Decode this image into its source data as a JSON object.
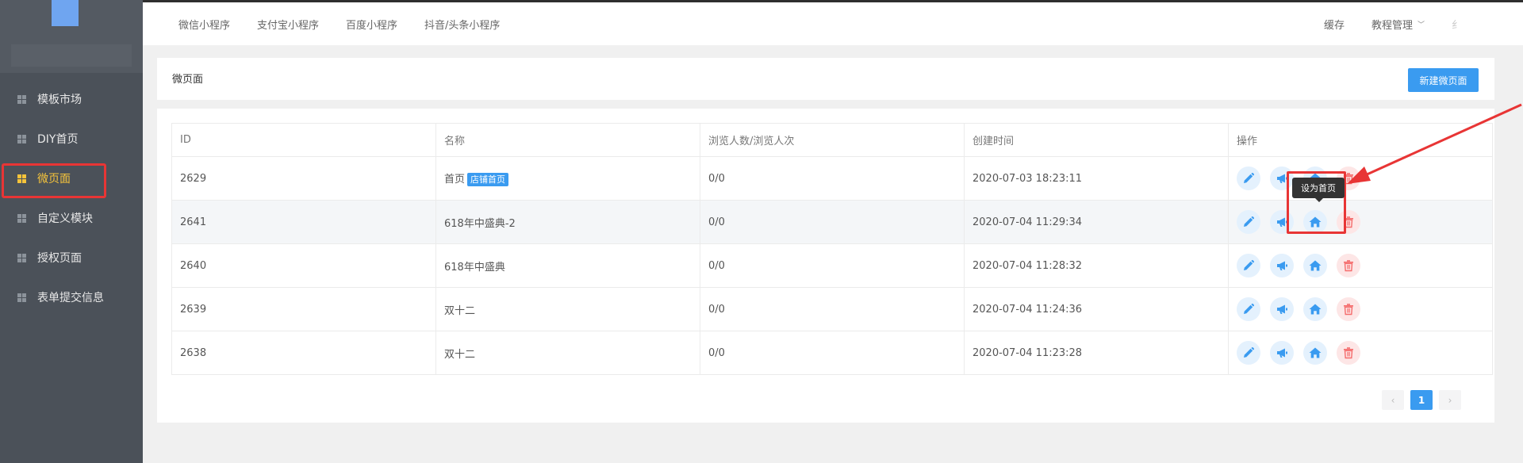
{
  "sidebar": {
    "items": [
      {
        "label": "模板市场",
        "active": false
      },
      {
        "label": "DIY首页",
        "active": false
      },
      {
        "label": "微页面",
        "active": true
      },
      {
        "label": "自定义模块",
        "active": false
      },
      {
        "label": "授权页面",
        "active": false
      },
      {
        "label": "表单提交信息",
        "active": false
      }
    ]
  },
  "topnav": {
    "tabs": [
      "微信小程序",
      "支付宝小程序",
      "百度小程序",
      "抖音/头条小程序"
    ],
    "cache_label": "缓存",
    "tutorial_label": "教程管理",
    "faded_label": "纟"
  },
  "header": {
    "title": "微页面",
    "new_button": "新建微页面"
  },
  "table": {
    "columns": [
      "ID",
      "名称",
      "浏览人数/浏览人次",
      "创建时间",
      "操作"
    ],
    "rows": [
      {
        "id": "2629",
        "name": "首页",
        "tag": "店铺首页",
        "views": "0/0",
        "created": "2020-07-03 18:23:11"
      },
      {
        "id": "2641",
        "name": "618年中盛典-2",
        "tag": "",
        "views": "0/0",
        "created": "2020-07-04 11:29:34"
      },
      {
        "id": "2640",
        "name": "618年中盛典",
        "tag": "",
        "views": "0/0",
        "created": "2020-07-04 11:28:32"
      },
      {
        "id": "2639",
        "name": "双十二",
        "tag": "",
        "views": "0/0",
        "created": "2020-07-04 11:24:36"
      },
      {
        "id": "2638",
        "name": "双十二",
        "tag": "",
        "views": "0/0",
        "created": "2020-07-04 11:23:28"
      }
    ]
  },
  "tooltip": {
    "text": "设为首页"
  },
  "pagination": {
    "current": "1",
    "prev": "‹",
    "next": "›"
  },
  "colors": {
    "primary": "#3a9bf0",
    "danger": "#f56c6c",
    "sidebar_bg": "#4b5159",
    "active_menu": "#f5c33b",
    "annotation_red": "#e83535"
  },
  "icons": {
    "edit": "pencil-icon",
    "promote": "megaphone-icon",
    "set_home": "home-icon",
    "delete": "trash-icon"
  }
}
